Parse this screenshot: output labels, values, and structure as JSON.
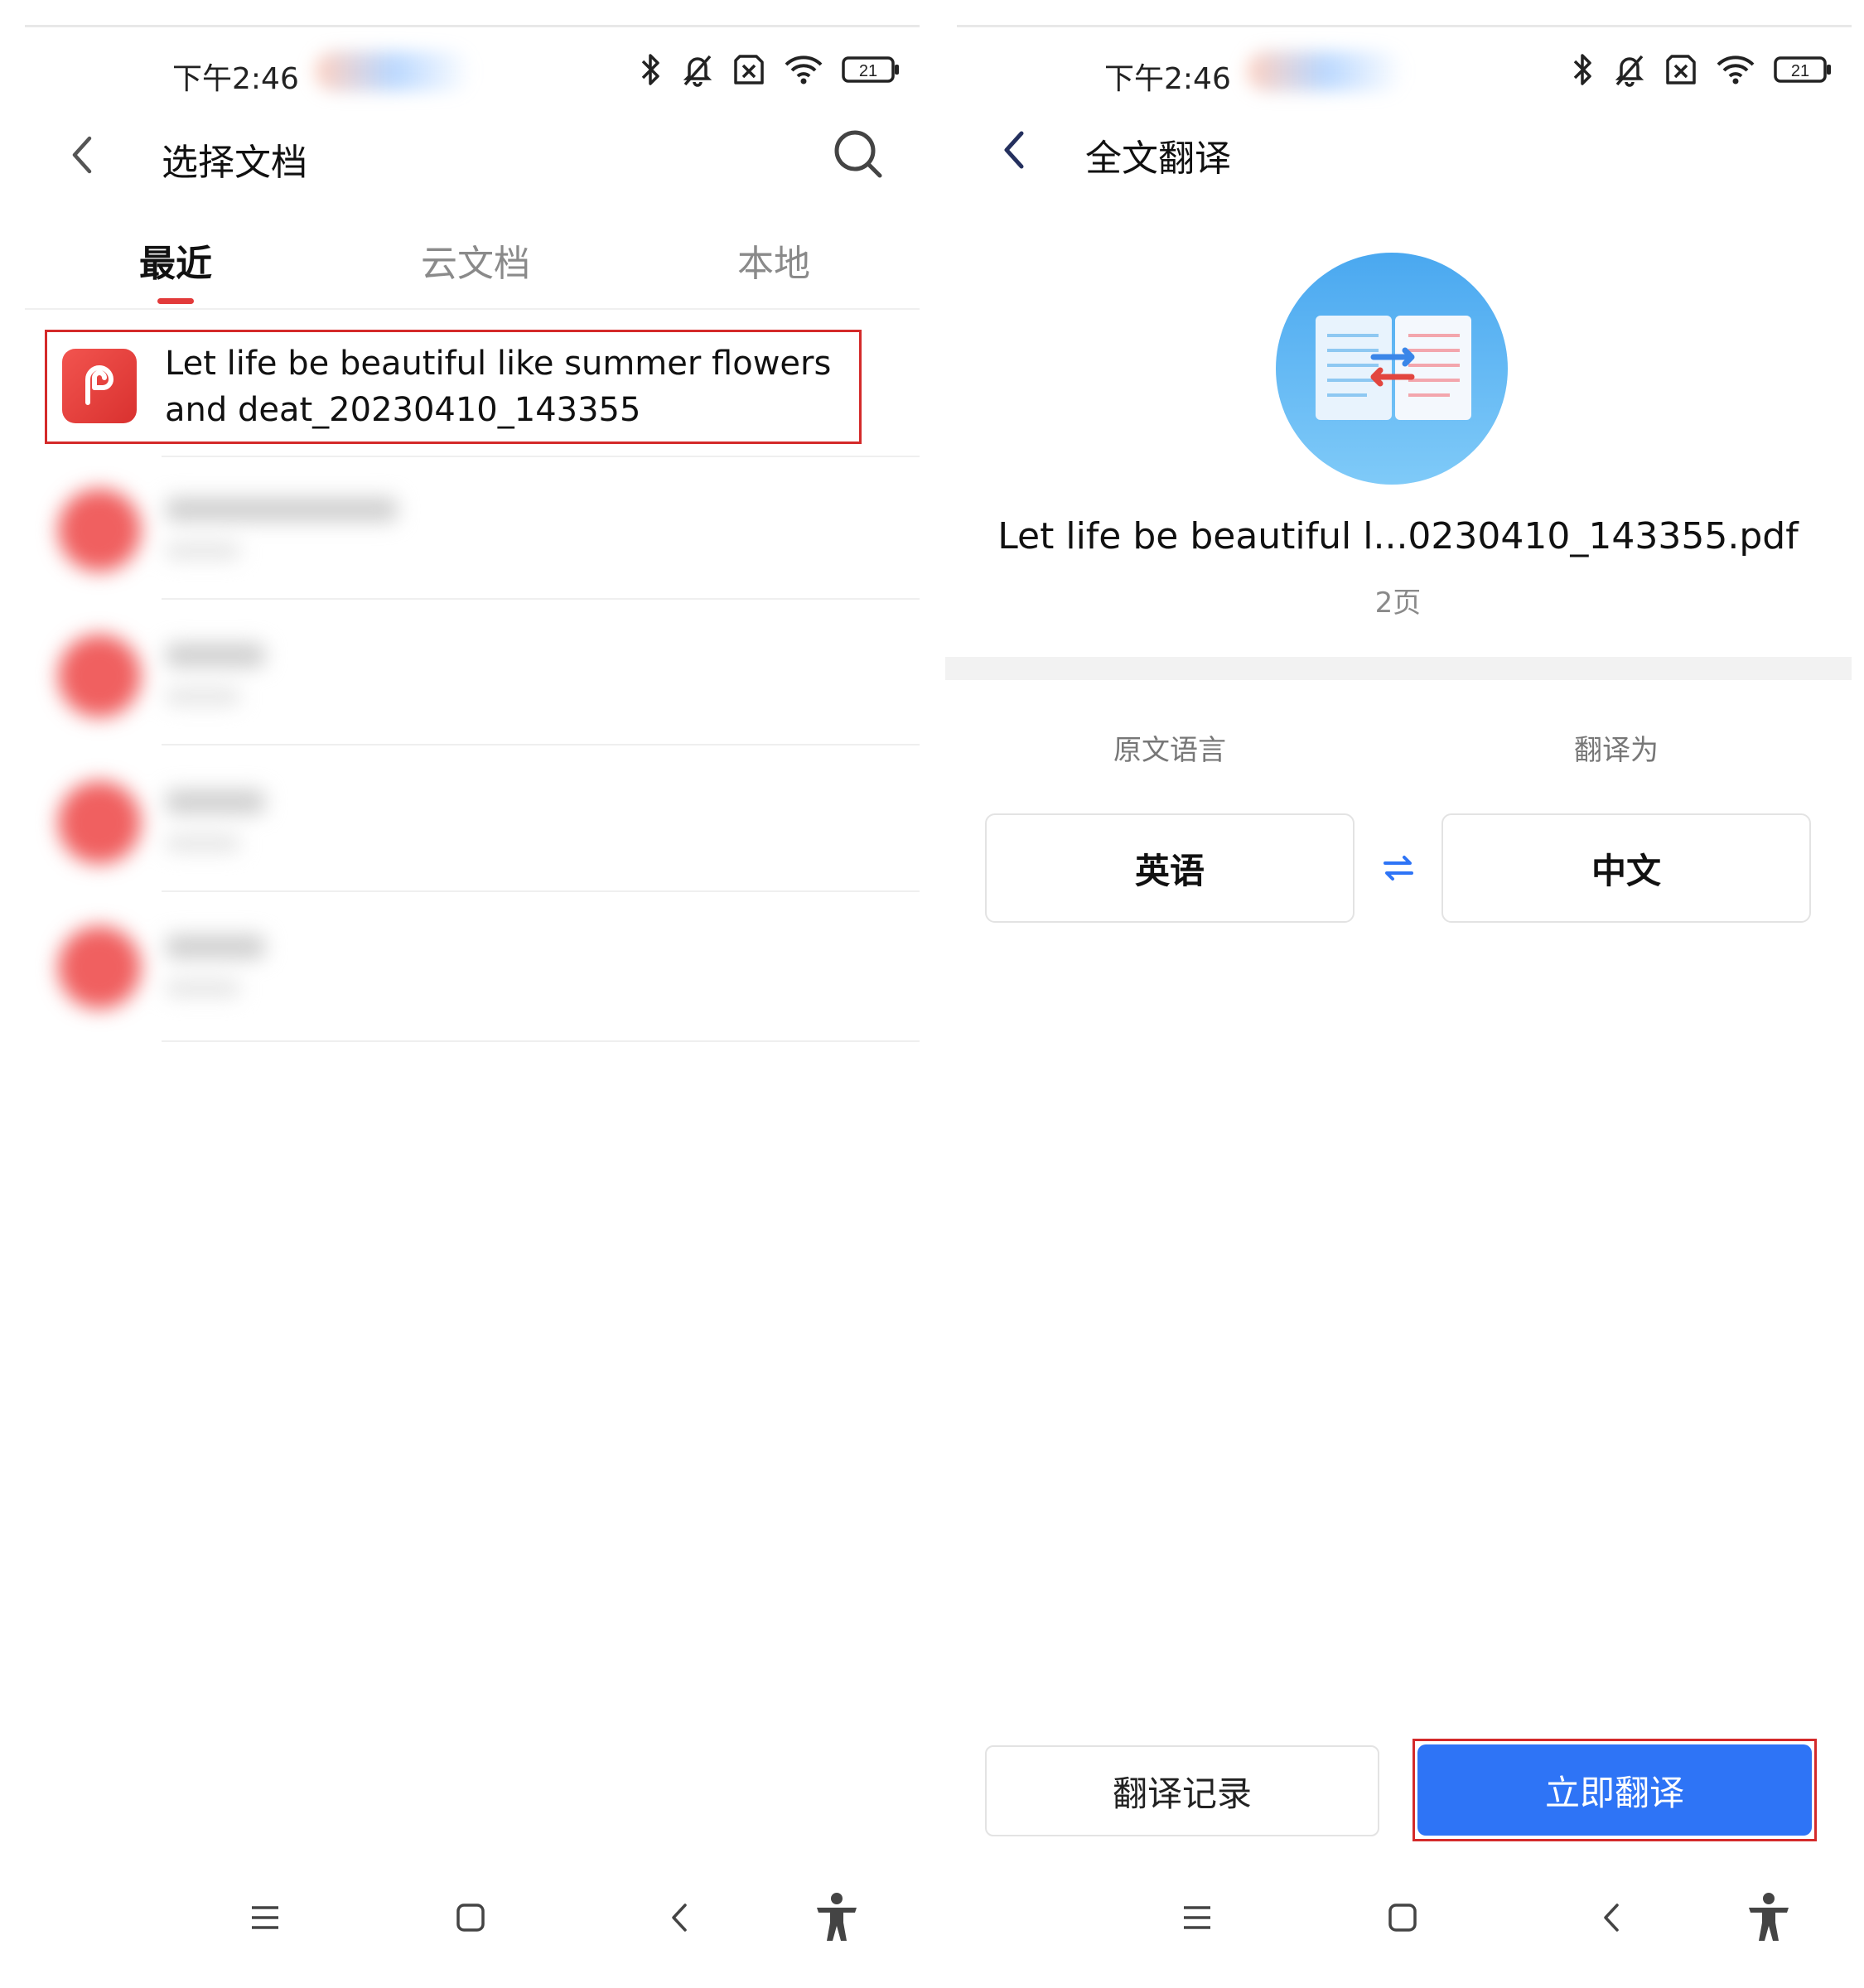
{
  "left": {
    "status": {
      "time": "下午2:46",
      "battery": "21"
    },
    "header": {
      "title": "选择文档"
    },
    "tabs": [
      {
        "label": "最近"
      },
      {
        "label": "云文档"
      },
      {
        "label": "本地"
      }
    ],
    "files": [
      {
        "name": "Let life be beautiful like summer flowers and deat_20230410_143355"
      }
    ]
  },
  "right": {
    "status": {
      "time": "下午2:46",
      "battery": "21"
    },
    "header": {
      "title": "全文翻译"
    },
    "document": {
      "name": "Let life be beautiful l...0230410_143355.pdf",
      "pages": "2页"
    },
    "source": {
      "label": "原文语言",
      "value": "英语"
    },
    "target": {
      "label": "翻译为",
      "value": "中文"
    },
    "buttons": {
      "history": "翻译记录",
      "translate": "立即翻译"
    }
  },
  "colors": {
    "accent_blue": "#2e74f6",
    "pdf_red": "#e23a3a",
    "highlight_red": "#d42a2a"
  },
  "icons": [
    "back-icon",
    "search-icon",
    "pdf-icon",
    "translate-book-icon",
    "swap-icon",
    "bluetooth-icon",
    "mute-icon",
    "sim-off-icon",
    "wifi-icon",
    "battery-icon",
    "menu-icon",
    "home-icon",
    "nav-back-icon",
    "accessibility-icon"
  ]
}
